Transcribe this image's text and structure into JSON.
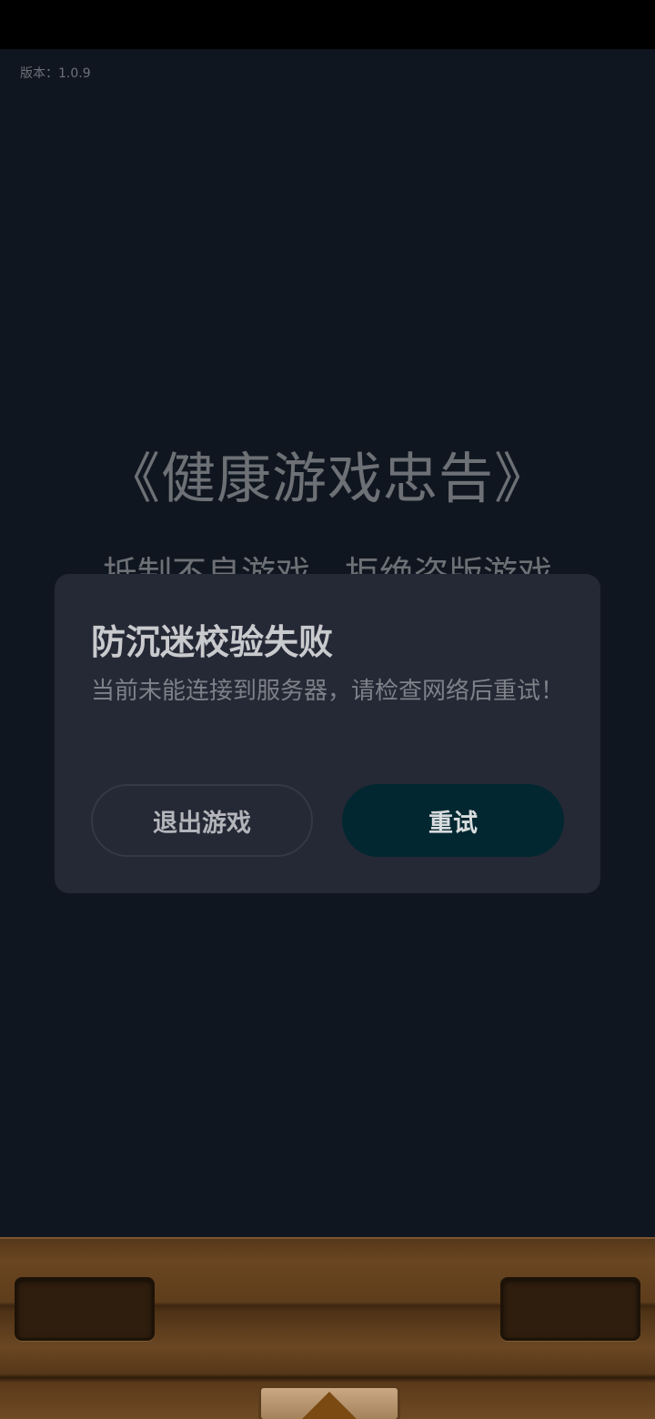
{
  "app": {
    "version_text": "版本：1.0.9"
  },
  "background": {
    "advice_title": "《健康游戏忠告》",
    "advice_line": "抵制不良游戏，拒绝盗版游戏"
  },
  "dialog": {
    "title": "防沉迷校验失败",
    "message": "当前未能连接到服务器，请检查网络后重试！",
    "exit_label": "退出游戏",
    "retry_label": "重试"
  },
  "colors": {
    "dialog_bg": "#252835",
    "retry_button_bg": "#022730",
    "game_bg": "#101620"
  },
  "icons": {
    "up_button": "up-triangle-icon"
  }
}
